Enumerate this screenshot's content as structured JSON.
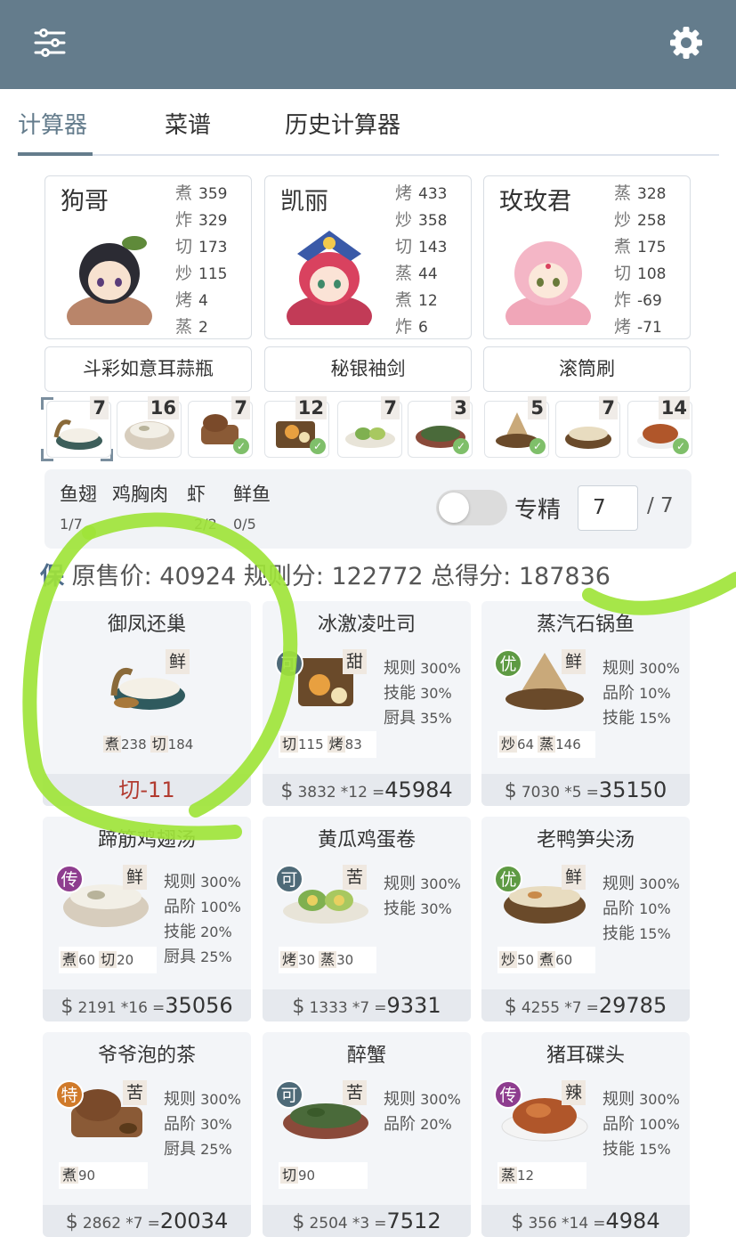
{
  "tabs": [
    {
      "label": "计算器",
      "active": true
    },
    {
      "label": "菜谱"
    },
    {
      "label": "历史计算器"
    }
  ],
  "chefs": [
    {
      "name": "狗哥",
      "skills": [
        {
          "k": "煮",
          "v": "359"
        },
        {
          "k": "炸",
          "v": "329"
        },
        {
          "k": "切",
          "v": "173"
        },
        {
          "k": "炒",
          "v": "115"
        },
        {
          "k": "烤",
          "v": "4"
        },
        {
          "k": "蒸",
          "v": "2"
        }
      ],
      "equip": "斗彩如意耳蒜瓶"
    },
    {
      "name": "凯丽",
      "skills": [
        {
          "k": "烤",
          "v": "433"
        },
        {
          "k": "炒",
          "v": "358"
        },
        {
          "k": "切",
          "v": "143"
        },
        {
          "k": "蒸",
          "v": "44"
        },
        {
          "k": "煮",
          "v": "12"
        },
        {
          "k": "炸",
          "v": "6"
        }
      ],
      "equip": "秘银袖剑"
    },
    {
      "name": "玫玫君",
      "skills": [
        {
          "k": "蒸",
          "v": "328"
        },
        {
          "k": "炒",
          "v": "258"
        },
        {
          "k": "煮",
          "v": "175"
        },
        {
          "k": "切",
          "v": "108"
        },
        {
          "k": "炸",
          "v": "-69"
        },
        {
          "k": "烤",
          "v": "-71"
        }
      ],
      "equip": "滚筒刷"
    }
  ],
  "slots": [
    {
      "count": "7",
      "checked": false,
      "selected": true
    },
    {
      "count": "16",
      "checked": false
    },
    {
      "count": "7",
      "checked": true
    },
    {
      "count": "12",
      "checked": true
    },
    {
      "count": "7",
      "checked": false
    },
    {
      "count": "3",
      "checked": true
    },
    {
      "count": "5",
      "checked": true
    },
    {
      "count": "7",
      "checked": false
    },
    {
      "count": "14",
      "checked": true
    }
  ],
  "ingredients": [
    {
      "name": "鱼翅",
      "count": "1/7"
    },
    {
      "name": "鸡胸肉",
      "count": ""
    },
    {
      "name": "虾",
      "count": "2/2"
    },
    {
      "name": "鲜鱼",
      "count": "0/5"
    }
  ],
  "specialty": {
    "label": "专精",
    "value": "7",
    "max": "/ 7"
  },
  "summary": {
    "prefix": "保",
    "price_label": "原售价:",
    "price": "40924",
    "rule_label": "规则分:",
    "rule": "122772",
    "total_label": "总得分:",
    "total": "187836"
  },
  "recipes": [
    {
      "name": "御凤还巢",
      "rarity": "",
      "taste": "鲜",
      "lines": [],
      "skills": [
        {
          "k": "煮",
          "v": "238"
        },
        {
          "k": "切",
          "v": "184"
        }
      ],
      "footer_warn": "切-11"
    },
    {
      "name": "冰激凌吐司",
      "rarity": "可",
      "rarity_color": "#4e6a78",
      "taste": "甜",
      "lines": [
        {
          "k": "规则",
          "v": "300%"
        },
        {
          "k": "技能",
          "v": "30%"
        },
        {
          "k": "厨具",
          "v": "35%"
        }
      ],
      "skills": [
        {
          "k": "切",
          "v": "115"
        },
        {
          "k": "烤",
          "v": "83"
        }
      ],
      "price": "3832",
      "mult": "*12",
      "total": "45984"
    },
    {
      "name": "蒸汽石锅鱼",
      "rarity": "优",
      "rarity_color": "#5e9a43",
      "taste": "鲜",
      "lines": [
        {
          "k": "规则",
          "v": "300%"
        },
        {
          "k": "品阶",
          "v": "10%"
        },
        {
          "k": "技能",
          "v": "15%"
        }
      ],
      "skills": [
        {
          "k": "炒",
          "v": "64"
        },
        {
          "k": "蒸",
          "v": "146"
        }
      ],
      "price": "7030",
      "mult": "*5",
      "total": "35150"
    },
    {
      "name": "蹄筋鸡翅汤",
      "rarity": "传",
      "rarity_color": "#8e3d8f",
      "taste": "鲜",
      "lines": [
        {
          "k": "规则",
          "v": "300%"
        },
        {
          "k": "品阶",
          "v": "100%"
        },
        {
          "k": "技能",
          "v": "20%"
        },
        {
          "k": "厨具",
          "v": "25%"
        }
      ],
      "skills": [
        {
          "k": "煮",
          "v": "60"
        },
        {
          "k": "切",
          "v": "20"
        }
      ],
      "price": "2191",
      "mult": "*16",
      "total": "35056"
    },
    {
      "name": "黄瓜鸡蛋卷",
      "rarity": "可",
      "rarity_color": "#4e6a78",
      "taste": "苦",
      "lines": [
        {
          "k": "规则",
          "v": "300%"
        },
        {
          "k": "技能",
          "v": "30%"
        }
      ],
      "skills": [
        {
          "k": "烤",
          "v": "30"
        },
        {
          "k": "蒸",
          "v": "30"
        }
      ],
      "price": "1333",
      "mult": "*7",
      "total": "9331"
    },
    {
      "name": "老鸭笋尖汤",
      "rarity": "优",
      "rarity_color": "#5e9a43",
      "taste": "鲜",
      "lines": [
        {
          "k": "规则",
          "v": "300%"
        },
        {
          "k": "品阶",
          "v": "10%"
        },
        {
          "k": "技能",
          "v": "15%"
        }
      ],
      "skills": [
        {
          "k": "炒",
          "v": "50"
        },
        {
          "k": "煮",
          "v": "60"
        }
      ],
      "price": "4255",
      "mult": "*7",
      "total": "29785"
    },
    {
      "name": "爷爷泡的茶",
      "rarity": "特",
      "rarity_color": "#d07a2a",
      "taste": "苦",
      "lines": [
        {
          "k": "规则",
          "v": "300%"
        },
        {
          "k": "品阶",
          "v": "30%"
        },
        {
          "k": "厨具",
          "v": "25%"
        }
      ],
      "skills": [
        {
          "k": "煮",
          "v": "90"
        }
      ],
      "price": "2862",
      "mult": "*7",
      "total": "20034"
    },
    {
      "name": "醉蟹",
      "rarity": "可",
      "rarity_color": "#4e6a78",
      "taste": "苦",
      "lines": [
        {
          "k": "规则",
          "v": "300%"
        },
        {
          "k": "品阶",
          "v": "20%"
        }
      ],
      "skills": [
        {
          "k": "切",
          "v": "90"
        }
      ],
      "price": "2504",
      "mult": "*3",
      "total": "7512"
    },
    {
      "name": "猪耳碟头",
      "rarity": "传",
      "rarity_color": "#8e3d8f",
      "taste": "辣",
      "lines": [
        {
          "k": "规则",
          "v": "300%"
        },
        {
          "k": "品阶",
          "v": "100%"
        },
        {
          "k": "技能",
          "v": "15%"
        }
      ],
      "skills": [
        {
          "k": "蒸",
          "v": "12"
        }
      ],
      "price": "356",
      "mult": "*14",
      "total": "4984"
    }
  ]
}
